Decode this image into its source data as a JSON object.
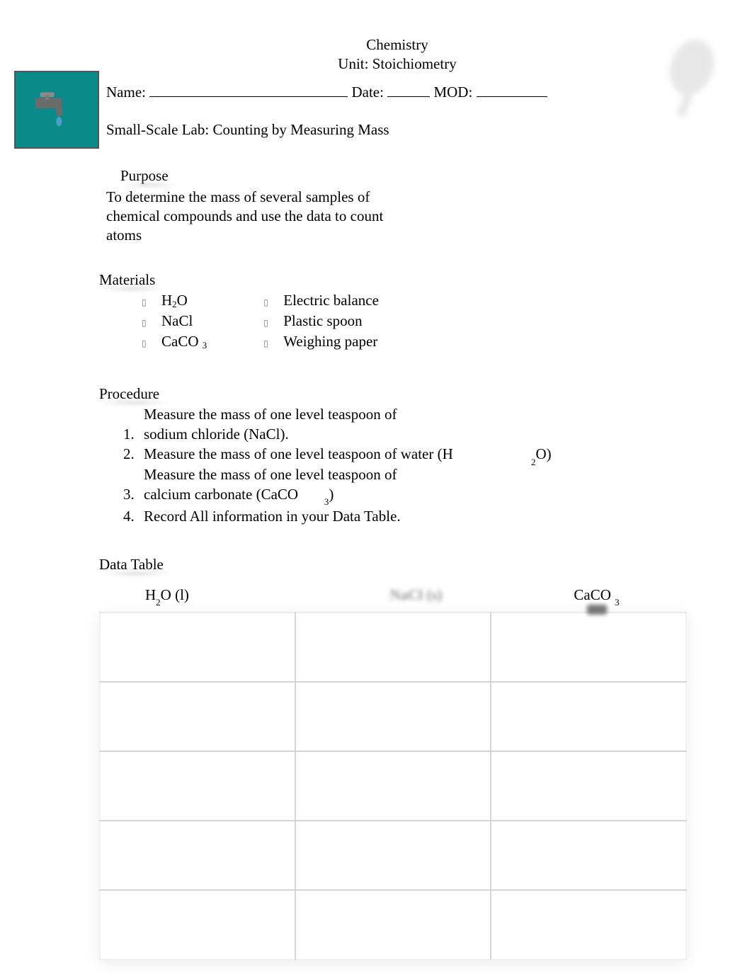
{
  "header": {
    "course": "Chemistry",
    "unit": "Unit: Stoichiometry"
  },
  "name_row": {
    "name_label": "Name: ",
    "date_label": " Date: ",
    "mod_label": " MOD: "
  },
  "lab_title": "Small-Scale Lab: Counting by Measuring Mass",
  "purpose": {
    "heading": "Purpose",
    "text": "To determine the mass of several samples of chemical compounds and use the data to count atoms"
  },
  "materials": {
    "heading": "Materials",
    "col1": {
      "a_pre": "H",
      "a_sub": "2",
      "a_post": "O",
      "b": "NaCl",
      "c_pre": "CaCO",
      "c_sub": "3"
    },
    "col2": {
      "a": "Electric balance",
      "b": "Plastic spoon",
      "c": "Weighing paper"
    }
  },
  "procedure": {
    "heading": "Procedure",
    "items": {
      "p1": "Measure the mass of one level teaspoon of sodium chloride (NaCl).",
      "p2a": "Measure the mass of one level teaspoon of water (H",
      "p2b_sub": "2",
      "p2c": "O)",
      "p3a": "Measure the mass of one level teaspoon of calcium carbonate (CaCO",
      "p3b_sub": "3",
      "p3c": ")",
      "p4": "Record All information in your Data Table."
    }
  },
  "data_table": {
    "heading": "Data Table",
    "cols": {
      "c1_pre": "H",
      "c1_sub": "2",
      "c1_post": "O (l)",
      "c2_blur": "NaCl (s)",
      "c3_pre": "CaCO",
      "c3_sub": "3"
    },
    "rows": 5
  },
  "icons": {
    "left": "faucet-icon",
    "right": "beaker-icon"
  }
}
